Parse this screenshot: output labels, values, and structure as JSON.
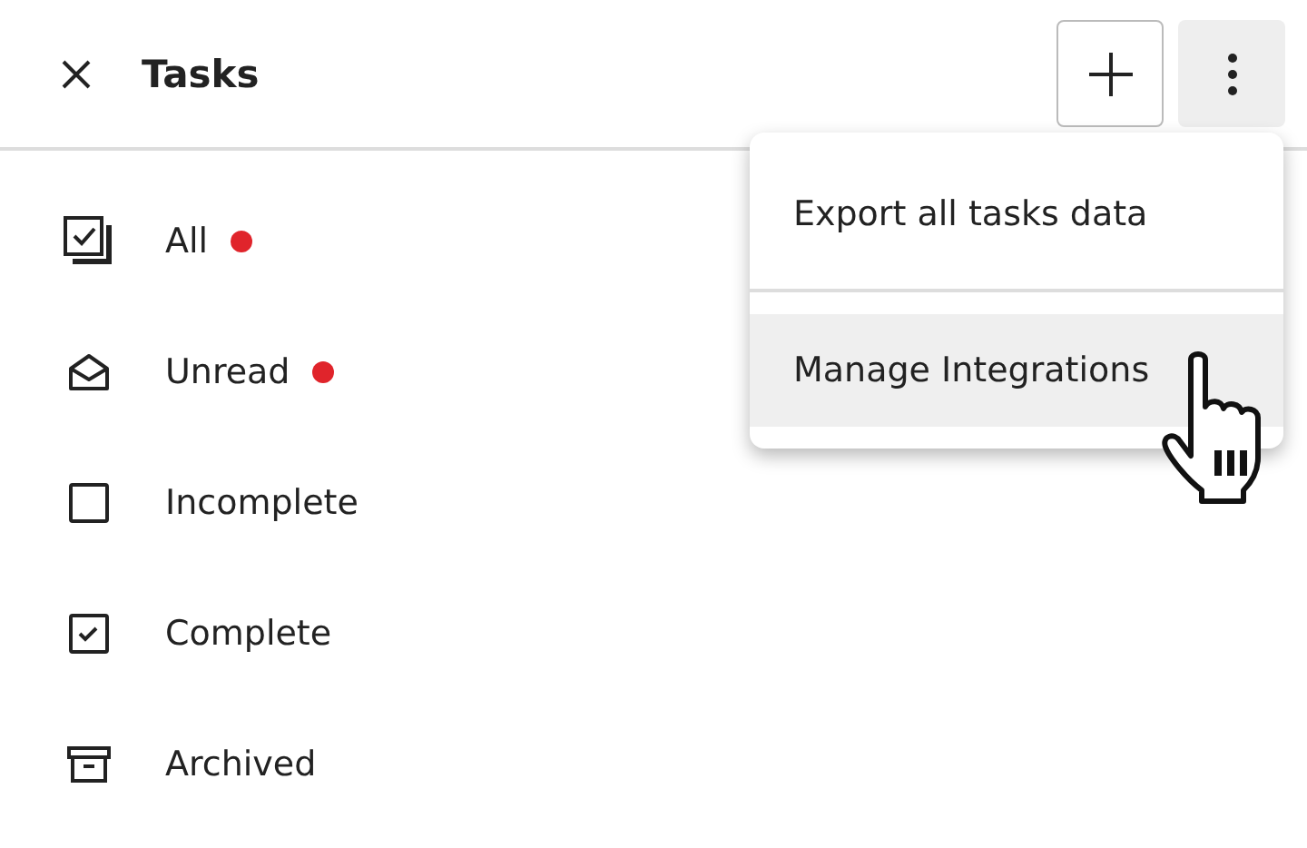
{
  "header": {
    "title": "Tasks"
  },
  "filters": [
    {
      "kind": "all",
      "label": "All",
      "dot": true
    },
    {
      "kind": "unread",
      "label": "Unread",
      "dot": true
    },
    {
      "kind": "incomplete",
      "label": "Incomplete",
      "dot": false
    },
    {
      "kind": "complete",
      "label": "Complete",
      "dot": false
    },
    {
      "kind": "archived",
      "label": "Archived",
      "dot": false
    }
  ],
  "menu": {
    "open": true,
    "items": [
      {
        "label": "Export all tasks data",
        "selected": false
      },
      {
        "label": "Manage Integrations",
        "selected": true
      }
    ]
  }
}
